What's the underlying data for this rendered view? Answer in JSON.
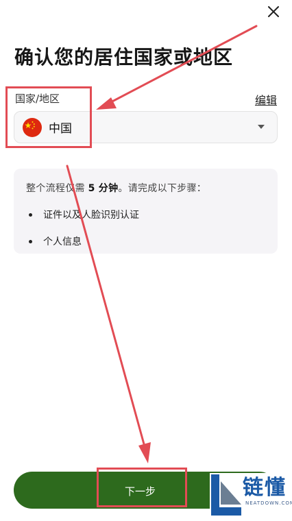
{
  "header": {
    "title": "确认您的居住国家或地区"
  },
  "country_field": {
    "label": "国家/地区",
    "edit_label": "编辑",
    "selected_value": "中国",
    "flag_icon": "china-flag-icon"
  },
  "info_card": {
    "intro_prefix": "整个流程仅需 ",
    "intro_duration": "5 分钟",
    "intro_suffix": "。请完成以下步骤：",
    "steps": [
      "证件以及人脸识别认证",
      "个人信息"
    ]
  },
  "footer": {
    "next_label": "下一步"
  },
  "watermark": {
    "brand_text": "链懂",
    "brand_url": "NEATDOWN.COM"
  },
  "colors": {
    "primary_button": "#2d6a1d",
    "annotation_red": "#e24c54",
    "card_background": "#f5f4f7",
    "field_background": "#f7f7f8"
  }
}
